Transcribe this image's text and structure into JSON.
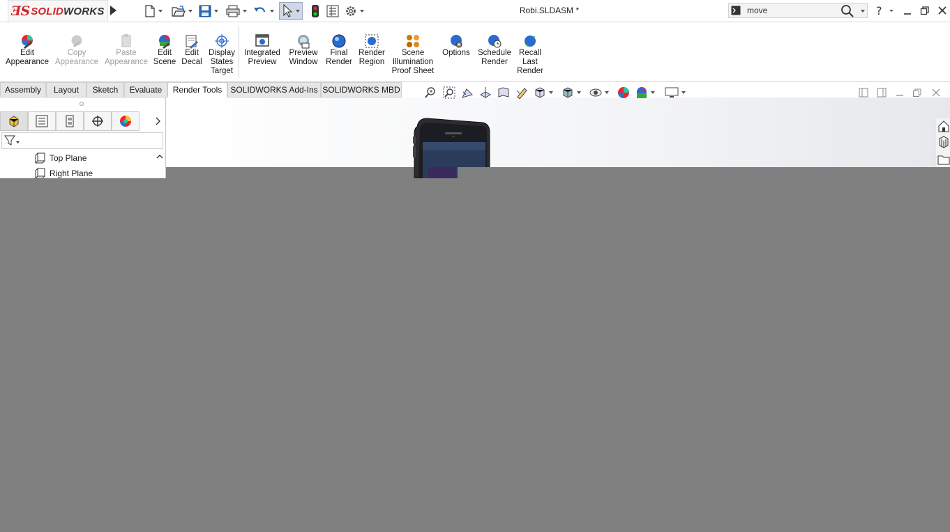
{
  "app": {
    "logo_ds": "ƎS",
    "logo_solid": "SOLID",
    "logo_works": "WORKS",
    "document_title": "Robi.SLDASM *"
  },
  "search": {
    "value": "move"
  },
  "ribbon": {
    "buttons": [
      {
        "label": "Edit\nAppearance",
        "icon": "edit-appearance-icon",
        "enabled": true
      },
      {
        "label": "Copy\nAppearance",
        "icon": "copy-appearance-icon",
        "enabled": false
      },
      {
        "label": "Paste\nAppearance",
        "icon": "paste-appearance-icon",
        "enabled": false
      },
      {
        "label": "Edit\nScene",
        "icon": "edit-scene-icon",
        "enabled": true
      },
      {
        "label": "Edit\nDecal",
        "icon": "edit-decal-icon",
        "enabled": true
      },
      {
        "label": "Display\nStates\nTarget",
        "icon": "display-states-target-icon",
        "enabled": true
      },
      {
        "label": "Integrated\nPreview",
        "icon": "integrated-preview-icon",
        "enabled": true
      },
      {
        "label": "Preview\nWindow",
        "icon": "preview-window-icon",
        "enabled": true
      },
      {
        "label": "Final\nRender",
        "icon": "final-render-icon",
        "enabled": true
      },
      {
        "label": "Render\nRegion",
        "icon": "render-region-icon",
        "enabled": true
      },
      {
        "label": "Scene\nIllumination\nProof Sheet",
        "icon": "scene-illumination-icon",
        "enabled": true
      },
      {
        "label": "Options",
        "icon": "options-icon",
        "enabled": true
      },
      {
        "label": "Schedule\nRender",
        "icon": "schedule-render-icon",
        "enabled": true
      },
      {
        "label": "Recall\nLast\nRender",
        "icon": "recall-last-render-icon",
        "enabled": true
      }
    ]
  },
  "tabs": [
    {
      "label": "Assembly",
      "active": false
    },
    {
      "label": "Layout",
      "active": false
    },
    {
      "label": "Sketch",
      "active": false
    },
    {
      "label": "Evaluate",
      "active": false
    },
    {
      "label": "Render Tools",
      "active": true
    },
    {
      "label": "SOLIDWORKS Add-Ins",
      "active": false
    },
    {
      "label": "SOLIDWORKS MBD",
      "active": false
    }
  ],
  "feature_tree": {
    "items": [
      {
        "label": "Top Plane",
        "icon": "plane-icon"
      },
      {
        "label": "Right Plane",
        "icon": "plane-icon"
      }
    ]
  },
  "colors": {
    "brand_red": "#d2232a",
    "background_grey": "#808080"
  }
}
